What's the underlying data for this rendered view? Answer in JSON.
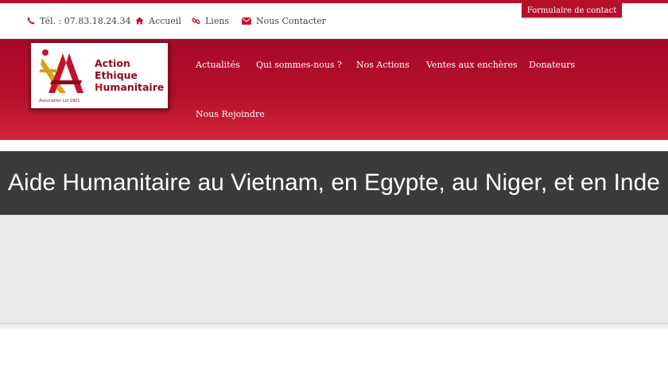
{
  "topbar": {
    "phone": "Tél. : 07.83.18.24.34",
    "home": "Accueil",
    "links": "Liens",
    "contact": "Nous Contacter",
    "contact_form": "Formulaire de contact"
  },
  "logo": {
    "line1": "Action",
    "line2": "Ethique",
    "line3_first": "H",
    "line3_rest": "umanitaire",
    "sub": "Association Loi 1901"
  },
  "nav": {
    "items": [
      "Actualités",
      "Qui sommes-nous ?",
      "Nos Actions",
      "Ventes aux enchères",
      "Donateurs",
      "Nous Rejoindre"
    ]
  },
  "page": {
    "title": "Aide Humanitaire au Vietnam, en Egypte, au Niger, et en Inde"
  },
  "colors": {
    "brand": "#b3102a",
    "title_band": "#3a3b3b"
  },
  "icons": {
    "phone": "phone-icon",
    "home": "home-icon",
    "links": "link-icon",
    "contact": "envelope-icon"
  }
}
